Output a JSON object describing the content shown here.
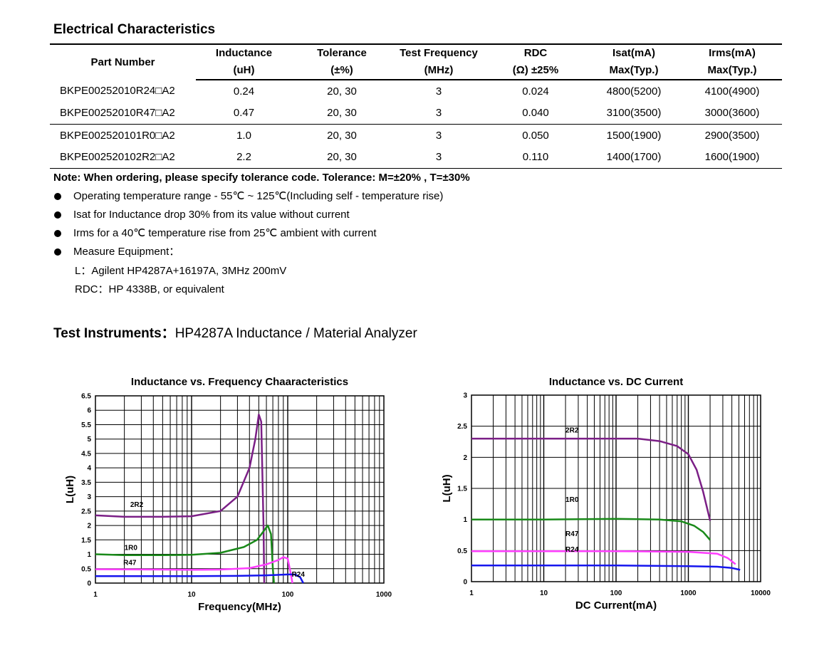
{
  "title": "Electrical Characteristics",
  "table": {
    "headers": [
      {
        "l1": "Part Number",
        "l2": ""
      },
      {
        "l1": "Inductance",
        "l2": "(uH)"
      },
      {
        "l1": "Tolerance",
        "l2": "(±%)"
      },
      {
        "l1": "Test Frequency",
        "l2": "(MHz)"
      },
      {
        "l1": "RDC",
        "l2": "(Ω) ±25%"
      },
      {
        "l1": "Isat(mA)",
        "l2": "Max(Typ.)"
      },
      {
        "l1": "Irms(mA)",
        "l2": "Max(Typ.)"
      }
    ],
    "rows": [
      [
        "BKPE00252010R24□A2",
        "0.24",
        "20, 30",
        "3",
        "0.024",
        "4800(5200)",
        "4100(4900)"
      ],
      [
        "BKPE00252010R47□A2",
        "0.47",
        "20, 30",
        "3",
        "0.040",
        "3100(3500)",
        "3000(3600)"
      ],
      [
        "BKPE002520101R0□A2",
        "1.0",
        "20, 30",
        "3",
        "0.050",
        "1500(1900)",
        "2900(3500)"
      ],
      [
        "BKPE002520102R2□A2",
        "2.2",
        "20, 30",
        "3",
        "0.110",
        "1400(1700)",
        "1600(1900)"
      ]
    ]
  },
  "note": "Note: When ordering, please specify tolerance code. Tolerance: M=±20% , T=±30%",
  "bullets": [
    "Operating temperature range - 55℃ ~ 125℃(Including self - temperature rise)",
    "Isat for Inductance drop 30% from its value without current",
    "Irms for a 40℃  temperature rise from 25℃  ambient with current",
    "Measure Equipment："
  ],
  "equipment": {
    "l": "L：Agilent HP4287A+16197A, 3MHz 200mV",
    "rdc": "RDC：HP 4338B, or equivalent"
  },
  "instruments": {
    "label": "Test Instruments：",
    "value": "HP4287A Inductance / Material Analyzer"
  },
  "chart_data": [
    {
      "type": "line",
      "title": "Inductance vs. Frequency Chaaracteristics",
      "xlabel": "Frequency(MHz)",
      "ylabel": "L(uH)",
      "xscale": "log",
      "xlim": [
        1,
        1000
      ],
      "ylim": [
        0,
        6.5
      ],
      "xticks": [
        "1",
        "10",
        "100",
        "1000"
      ],
      "yticks": [
        "0",
        "0.5",
        "1",
        "1.5",
        "2",
        "2.5",
        "3",
        "3.5",
        "4",
        "4.5",
        "5",
        "5.5",
        "6",
        "6.5"
      ],
      "grid": true,
      "series": [
        {
          "name": "2R2",
          "color": "#7b1f86",
          "points": [
            [
              1,
              2.35
            ],
            [
              2,
              2.3
            ],
            [
              5,
              2.3
            ],
            [
              10,
              2.32
            ],
            [
              20,
              2.5
            ],
            [
              30,
              3.0
            ],
            [
              40,
              4.0
            ],
            [
              46,
              5.0
            ],
            [
              50,
              5.85
            ],
            [
              53,
              5.6
            ],
            [
              56,
              2.0
            ],
            [
              57,
              0
            ]
          ]
        },
        {
          "name": "1R0",
          "color": "#1a8a1a",
          "points": [
            [
              1,
              1.0
            ],
            [
              2,
              0.97
            ],
            [
              5,
              0.97
            ],
            [
              10,
              0.98
            ],
            [
              20,
              1.05
            ],
            [
              35,
              1.25
            ],
            [
              48,
              1.5
            ],
            [
              56,
              1.8
            ],
            [
              62,
              2.0
            ],
            [
              67,
              1.7
            ],
            [
              70,
              0.5
            ],
            [
              72,
              0
            ]
          ]
        },
        {
          "name": "R47",
          "color": "#ff3dff",
          "points": [
            [
              1,
              0.48
            ],
            [
              5,
              0.47
            ],
            [
              10,
              0.46
            ],
            [
              20,
              0.47
            ],
            [
              40,
              0.52
            ],
            [
              60,
              0.65
            ],
            [
              80,
              0.8
            ],
            [
              90,
              0.9
            ],
            [
              100,
              0.85
            ],
            [
              108,
              0.3
            ],
            [
              112,
              0
            ]
          ]
        },
        {
          "name": "R24",
          "color": "#1515ee",
          "points": [
            [
              1,
              0.24
            ],
            [
              5,
              0.24
            ],
            [
              10,
              0.24
            ],
            [
              30,
              0.25
            ],
            [
              60,
              0.27
            ],
            [
              100,
              0.3
            ],
            [
              120,
              0.3
            ],
            [
              135,
              0.2
            ],
            [
              145,
              0
            ]
          ]
        }
      ]
    },
    {
      "type": "line",
      "title": "Inductance vs. DC Current",
      "xlabel": "DC Current(mA)",
      "ylabel": "L(uH)",
      "xscale": "log",
      "xlim": [
        1,
        10000
      ],
      "ylim": [
        0,
        3
      ],
      "xticks": [
        "1",
        "10",
        "100",
        "1000",
        "10000"
      ],
      "yticks": [
        "0",
        "0.5",
        "1",
        "1.5",
        "2",
        "2.5",
        "3"
      ],
      "grid": true,
      "series": [
        {
          "name": "2R2",
          "color": "#7b1f86",
          "points": [
            [
              1,
              2.3
            ],
            [
              10,
              2.3
            ],
            [
              100,
              2.3
            ],
            [
              200,
              2.3
            ],
            [
              400,
              2.26
            ],
            [
              700,
              2.18
            ],
            [
              1000,
              2.05
            ],
            [
              1300,
              1.8
            ],
            [
              1600,
              1.45
            ],
            [
              2000,
              0.98
            ]
          ]
        },
        {
          "name": "1R0",
          "color": "#1a8a1a",
          "points": [
            [
              1,
              1.0
            ],
            [
              10,
              1.0
            ],
            [
              100,
              1.01
            ],
            [
              400,
              1.0
            ],
            [
              800,
              0.97
            ],
            [
              1200,
              0.9
            ],
            [
              1600,
              0.8
            ],
            [
              2000,
              0.67
            ]
          ]
        },
        {
          "name": "R47",
          "color": "#ff3dff",
          "points": [
            [
              1,
              0.49
            ],
            [
              10,
              0.49
            ],
            [
              100,
              0.49
            ],
            [
              1000,
              0.48
            ],
            [
              2500,
              0.45
            ],
            [
              3500,
              0.38
            ],
            [
              4500,
              0.28
            ]
          ]
        },
        {
          "name": "R24",
          "color": "#1515ee",
          "points": [
            [
              1,
              0.26
            ],
            [
              10,
              0.26
            ],
            [
              100,
              0.26
            ],
            [
              1000,
              0.25
            ],
            [
              2500,
              0.24
            ],
            [
              4000,
              0.22
            ],
            [
              5200,
              0.19
            ]
          ]
        }
      ]
    }
  ]
}
